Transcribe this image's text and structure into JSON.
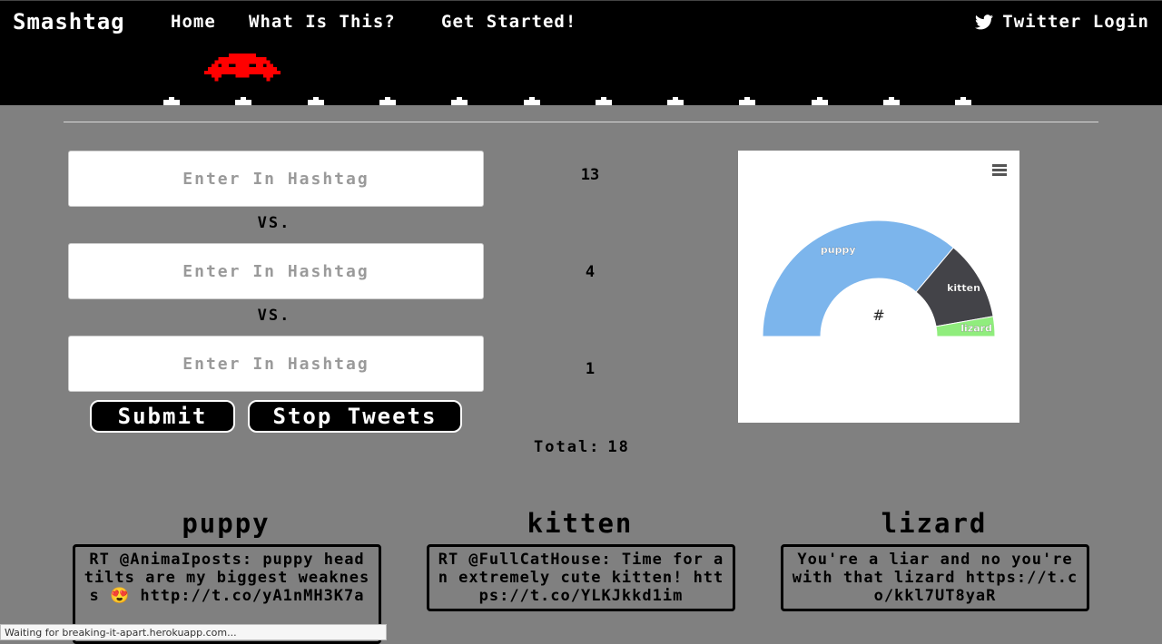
{
  "nav": {
    "brand": "Smashtag",
    "links": [
      "Home",
      "What Is This?",
      "Get Started!"
    ],
    "twitter_login": "Twitter Login",
    "twitter_icon": "twitter-bird-icon"
  },
  "form": {
    "placeholder": "Enter In Hashtag",
    "vs_label": "VS.",
    "submit_label": "Submit",
    "stop_label": "Stop Tweets",
    "counts": [
      "13",
      "4",
      "1"
    ],
    "total_label": "Total:",
    "total_value": "18"
  },
  "chart_data": {
    "type": "pie",
    "variant": "semi-circle donut",
    "center_label": "#",
    "labels": [
      "puppy",
      "kitten",
      "lizard"
    ],
    "values": [
      13,
      4,
      1
    ],
    "colors": [
      "#7cb5ec",
      "#434348",
      "#90ed7d"
    ],
    "menu_icon": "hamburger-menu-icon"
  },
  "columns": [
    {
      "title": "puppy",
      "tweet": "RT @AnimaIposts: puppy head tilts are my biggest weakness 😍 http://t.co/yA1nMH3K7a"
    },
    {
      "title": "kitten",
      "tweet": "RT @FullCatHouse: Time for an extremely cute kitten! https://t.co/YLKJkkd1im"
    },
    {
      "title": "lizard",
      "tweet": "You're a liar and no you're with that lizard https://t.co/kkl7UT8yaR"
    }
  ],
  "status": "Waiting for breaking-it-apart.herokuapp.com..."
}
